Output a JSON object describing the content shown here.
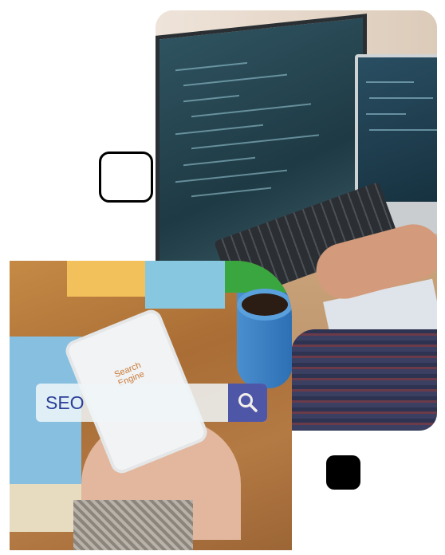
{
  "hero_image_top": {
    "description_icon": "developer-coding-photo"
  },
  "hero_image_bottom": {
    "phone_screen_text": "Search Engine",
    "search_bar": {
      "value": "SEO",
      "icon": "search-icon",
      "button_color": "#4e56a8",
      "text_color": "#2b3f9a"
    }
  },
  "decorations": {
    "outline_square_color": "#000000",
    "filled_square_color": "#000000"
  }
}
